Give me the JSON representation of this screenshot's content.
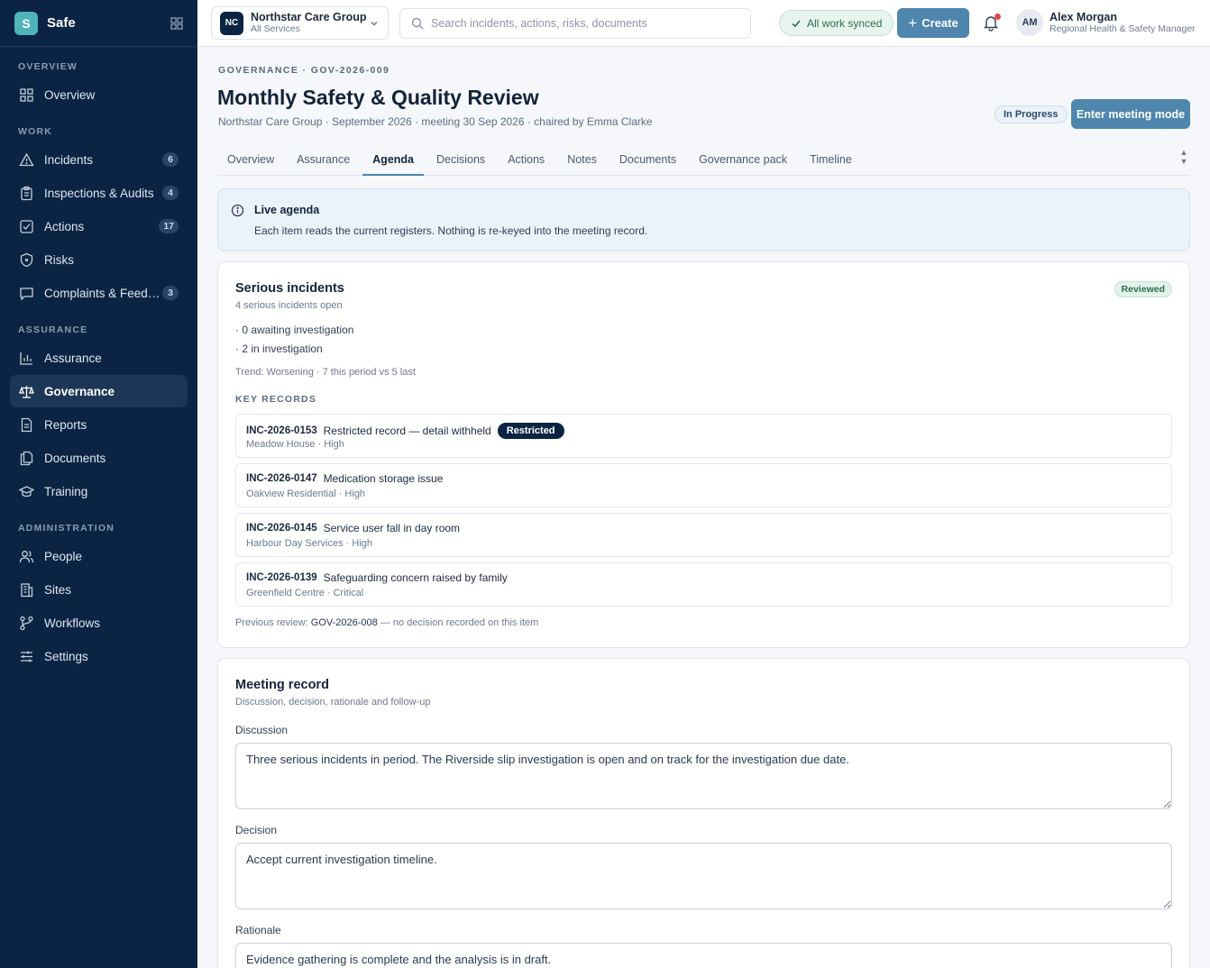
{
  "app": {
    "logo_letter": "S",
    "name": "Safe"
  },
  "sidebar": {
    "sections": [
      {
        "heading": "OVERVIEW",
        "items": [
          {
            "label": "Overview",
            "icon": "dashboard-grid-icon"
          }
        ]
      },
      {
        "heading": "WORK",
        "items": [
          {
            "label": "Incidents",
            "icon": "warning-triangle-icon",
            "badge": "6"
          },
          {
            "label": "Inspections & Audits",
            "icon": "clipboard-icon",
            "badge": "4"
          },
          {
            "label": "Actions",
            "icon": "checkbox-icon",
            "badge": "17"
          },
          {
            "label": "Risks",
            "icon": "shield-icon"
          },
          {
            "label": "Complaints & Feedback",
            "icon": "chat-bubble-icon",
            "badge": "3"
          }
        ]
      },
      {
        "heading": "ASSURANCE",
        "items": [
          {
            "label": "Assurance",
            "icon": "bar-chart-icon"
          },
          {
            "label": "Governance",
            "icon": "scales-icon",
            "active": true
          },
          {
            "label": "Reports",
            "icon": "report-document-icon"
          },
          {
            "label": "Documents",
            "icon": "documents-icon"
          },
          {
            "label": "Training",
            "icon": "graduation-cap-icon"
          }
        ]
      },
      {
        "heading": "ADMINISTRATION",
        "items": [
          {
            "label": "People",
            "icon": "people-icon"
          },
          {
            "label": "Sites",
            "icon": "building-icon"
          },
          {
            "label": "Workflows",
            "icon": "workflow-branch-icon"
          },
          {
            "label": "Settings",
            "icon": "sliders-icon"
          }
        ]
      }
    ]
  },
  "topbar": {
    "org": {
      "initials": "NC",
      "name": "Northstar Care Group",
      "scope": "All Services"
    },
    "search_placeholder": "Search incidents, actions, risks, documents",
    "sync_status": "All work synced",
    "create_label": "Create",
    "user": {
      "initials": "AM",
      "name": "Alex Morgan",
      "role": "Regional Health & Safety Manager"
    }
  },
  "page": {
    "breadcrumb": "GOVERNANCE · GOV-2026-009",
    "title": "Monthly Safety & Quality Review",
    "subtitle": "Northstar Care Group · September 2026 · meeting 30 Sep 2026 · chaired by Emma Clarke",
    "status": "In Progress",
    "meeting_mode_label": "Enter meeting mode",
    "tabs": [
      "Overview",
      "Assurance",
      "Agenda",
      "Decisions",
      "Actions",
      "Notes",
      "Documents",
      "Governance pack",
      "Timeline"
    ],
    "active_tab": "Agenda"
  },
  "live_agenda": {
    "title": "Live agenda",
    "text": "Each item reads the current registers. Nothing is re-keyed into the meeting record."
  },
  "serious_incidents": {
    "title": "Serious incidents",
    "subtitle": "4 serious incidents open",
    "status": "Reviewed",
    "bullets": [
      "· 0 awaiting investigation",
      "· 2 in investigation"
    ],
    "trend": "Trend: Worsening · 7 this period vs 5 last",
    "key_records_heading": "KEY RECORDS",
    "records": [
      {
        "id": "INC-2026-0153",
        "title": "Restricted record — detail withheld",
        "meta": "Meadow House · High",
        "badge": "Restricted"
      },
      {
        "id": "INC-2026-0147",
        "title": "Medication storage issue",
        "meta": "Oakview Residential · High"
      },
      {
        "id": "INC-2026-0145",
        "title": "Service user fall in day room",
        "meta": "Harbour Day Services · High"
      },
      {
        "id": "INC-2026-0139",
        "title": "Safeguarding concern raised by family",
        "meta": "Greenfield Centre · Critical"
      }
    ],
    "previous_review_prefix": "Previous review: ",
    "previous_review_link": "GOV-2026-008",
    "previous_review_suffix": " — no decision recorded on this item"
  },
  "meeting_record": {
    "title": "Meeting record",
    "subtitle": "Discussion, decision, rationale and follow-up",
    "fields": [
      {
        "label": "Discussion",
        "value": "Three serious incidents in period. The Riverside slip investigation is open and on track for the investigation due date."
      },
      {
        "label": "Decision",
        "value": "Accept current investigation timeline."
      },
      {
        "label": "Rationale",
        "value": "Evidence gathering is complete and the analysis is in draft."
      }
    ]
  },
  "colors": {
    "sidebar_bg": "#0b2443",
    "accent": "#4f86ad",
    "brand_logo": "#4fb3b9",
    "reviewed": "#2c6d4f",
    "notification_dot": "#e0464a"
  }
}
